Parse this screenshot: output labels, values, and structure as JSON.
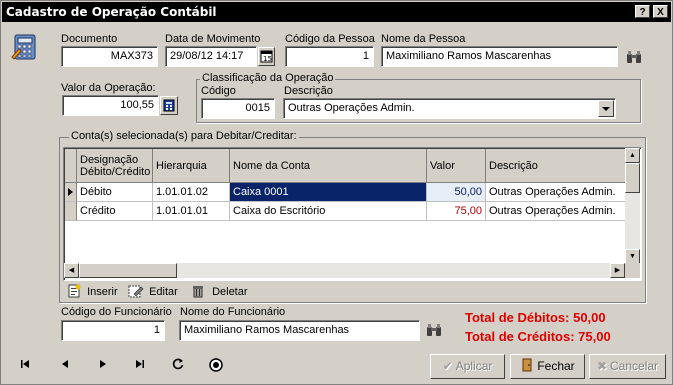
{
  "window": {
    "title": "Cadastro de Operação Contábil",
    "help_btn": "?",
    "close_btn": "X"
  },
  "form": {
    "documento_label": "Documento",
    "documento_value": "MAX373",
    "data_label": "Data de Movimento",
    "data_value": "29/08/12 14:17",
    "codigo_pessoa_label": "Código da Pessoa",
    "codigo_pessoa_value": "1",
    "nome_pessoa_label": "Nome da Pessoa",
    "nome_pessoa_value": "Maximiliano Ramos Mascarenhas",
    "valor_label": "Valor da Operação:",
    "valor_value": "100,55",
    "classificacao_title": "Classificação da Operação",
    "codigo_label": "Código",
    "codigo_value": "0015",
    "descricao_label": "Descrição",
    "descricao_value": "Outras Operações Admin."
  },
  "contas": {
    "group_title": "Conta(s) selecionada(s) para Debitar/Creditar:",
    "columns": {
      "designacao": "Designação Débito/Crédito",
      "hierarquia": "Hierarquia",
      "nome_conta": "Nome da Conta",
      "valor": "Valor",
      "descricao": "Descrição"
    },
    "rows": [
      {
        "designacao": "Débito",
        "hierarquia": "1.01.01.02",
        "nome_conta": "Caixa 0001",
        "valor": "50,00",
        "descricao": "Outras Operações Admin."
      },
      {
        "designacao": "Crédito",
        "hierarquia": "1.01.01.01",
        "nome_conta": "Caixa do Escritório",
        "valor": "75,00",
        "descricao": "Outras Operações Admin."
      }
    ],
    "toolbar": {
      "inserir": "Inserir",
      "editar": "Editar",
      "deletar": "Deletar"
    }
  },
  "funcionario": {
    "codigo_label": "Código do Funcionário",
    "codigo_value": "1",
    "nome_label": "Nome do Funcionário",
    "nome_value": "Maximiliano Ramos Mascarenhas"
  },
  "totals": {
    "debitos": "Total de Débitos: 50,00",
    "creditos": "Total de Créditos: 75,00"
  },
  "buttons": {
    "aplicar": "Aplicar",
    "fechar": "Fechar",
    "cancelar": "Cancelar"
  },
  "colors": {
    "title_bar": "#000000",
    "total_red": "#e00000",
    "selected_cell": "#0a246a",
    "credit_value": "#b00000"
  }
}
